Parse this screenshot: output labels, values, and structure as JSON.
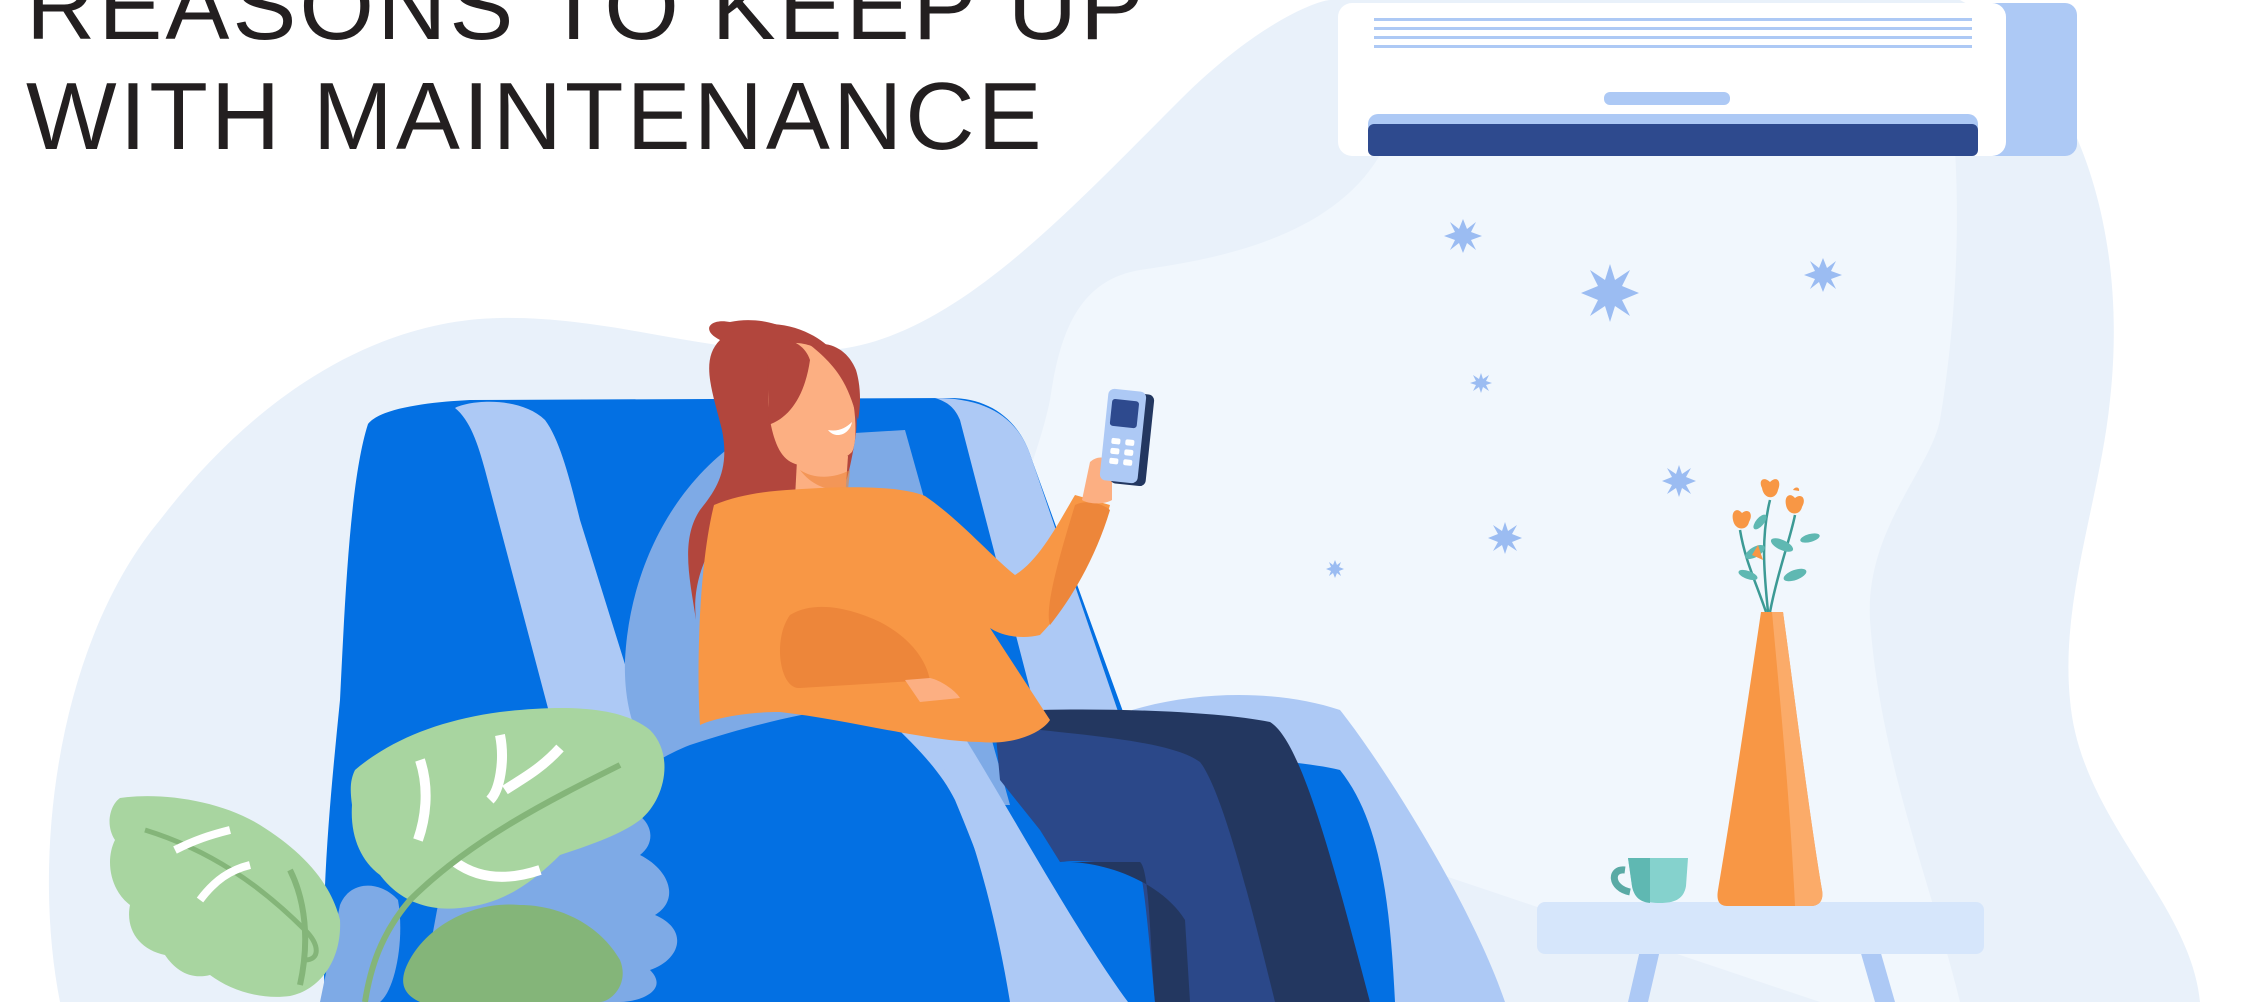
{
  "headline": {
    "text": "REASONS TO KEEP UP\nWITH MAINTENANCE"
  },
  "illustration": {
    "subject": "woman relaxing in armchair holding air-conditioner remote",
    "icons": [
      "air-conditioner-icon",
      "snowflake-icon",
      "remote-control-icon",
      "plant-icon",
      "vase-icon",
      "cup-icon",
      "armchair-icon",
      "side-table-icon"
    ],
    "colors": {
      "background_blob": "#e9f1fa",
      "air_stream": "#eff6fc",
      "ac_body": "#ffffff",
      "ac_side": "#adc9f5",
      "ac_vent": "#2e4a8e",
      "chair": "#0370e3",
      "chair_trim": "#adc9f5",
      "chair_shadow": "#7eaae6",
      "sweater": "#f89745",
      "sweater_shadow": "#ed863a",
      "skin": "#fcaf82",
      "hair": "#b2463d",
      "pants": "#2b4889",
      "pants_dark": "#233760",
      "leaf": "#a8d5a0",
      "leaf_dark": "#84b579",
      "vase": "#f89745",
      "table": "#d6e6fb",
      "cup": "#85d2cd",
      "snowflake": "#9bbcf2",
      "text": "#231f20"
    }
  }
}
